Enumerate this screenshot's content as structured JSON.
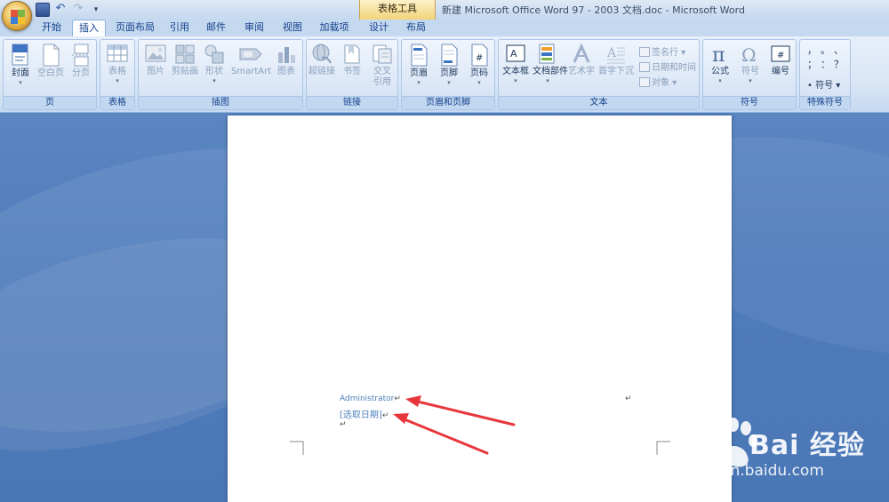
{
  "window": {
    "context_tab": "表格工具",
    "title": "新建 Microsoft Office Word 97 - 2003 文档.doc - Microsoft Word"
  },
  "tabs": [
    {
      "label": "开始",
      "active": false
    },
    {
      "label": "插入",
      "active": true
    },
    {
      "label": "页面布局",
      "active": false
    },
    {
      "label": "引用",
      "active": false
    },
    {
      "label": "邮件",
      "active": false
    },
    {
      "label": "审阅",
      "active": false
    },
    {
      "label": "视图",
      "active": false
    },
    {
      "label": "加载项",
      "active": false
    },
    {
      "label": "设计",
      "active": false
    },
    {
      "label": "布局",
      "active": false
    }
  ],
  "ribbon": {
    "page": {
      "label": "页",
      "cover": "封面",
      "blank": "空白页",
      "break": "分页"
    },
    "table": {
      "label": "表格",
      "table": "表格"
    },
    "illustrations": {
      "label": "插图",
      "picture": "图片",
      "clipart": "剪贴画",
      "shapes": "形状",
      "smartart": "SmartArt",
      "chart": "图表"
    },
    "links": {
      "label": "链接",
      "hyperlink": "超链接",
      "bookmark": "书签",
      "crossref_1": "交叉",
      "crossref_2": "引用"
    },
    "header_footer": {
      "label": "页眉和页脚",
      "header": "页眉",
      "footer": "页脚",
      "page_number": "页码"
    },
    "text": {
      "label": "文本",
      "textbox": "文本框",
      "quickparts": "文档部件",
      "wordart": "艺术字",
      "dropcap": "首字下沉",
      "signature": "签名行",
      "datetime": "日期和时间",
      "object": "对象"
    },
    "symbols": {
      "label": "符号",
      "equation": "公式",
      "symbol": "符号",
      "numbering": "编号"
    },
    "special": {
      "label": "特殊符号",
      "symbol_btn": "符号",
      "chars": [
        "，",
        "。",
        "、",
        "；",
        "：",
        "？"
      ]
    }
  },
  "document": {
    "author": "Administrator",
    "date_placeholder": "[选取日期]"
  },
  "watermark": {
    "brand": "Bai 经验",
    "url": "jingyan.baidu.com"
  },
  "colors": {
    "accent_arrow": "#e8373c",
    "doc_text": "#4f81bd",
    "doc_background": "#4f7cbb"
  }
}
